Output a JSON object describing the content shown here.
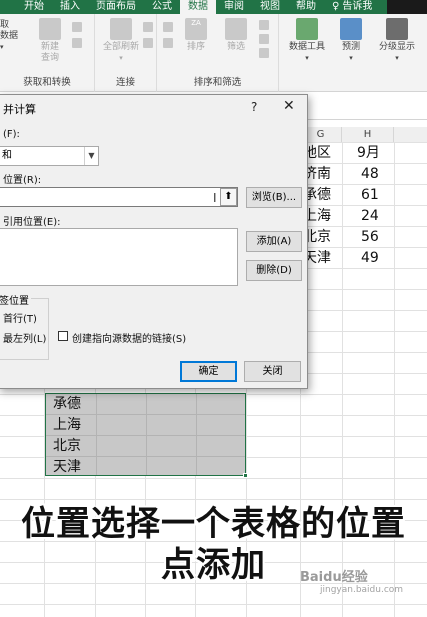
{
  "ribbon_tabs": [
    "开始",
    "插入",
    "页面布局",
    "公式",
    "数据",
    "审阅",
    "视图",
    "帮助",
    "告诉我"
  ],
  "active_tab": "数据",
  "ribbon": {
    "get_data": {
      "label_line1": "取",
      "label_line2": "数据",
      "group_label": "获取和转换",
      "new_query_line1": "新建",
      "new_query_line2": "查询"
    },
    "connections": {
      "refresh_all": "全部刷新",
      "group_label": "连接"
    },
    "sort_filter": {
      "sort": "排序",
      "filter": "筛选",
      "group_label": "排序和筛选",
      "za": "ZA"
    },
    "data_tools": "数据工具",
    "forecast": "预测",
    "outline": "分级显示"
  },
  "sheet": {
    "columns": [
      "G",
      "H"
    ],
    "table_header": {
      "region": "地区",
      "month": "9月"
    },
    "table_rows": [
      {
        "region": "济南",
        "value": "48"
      },
      {
        "region": "承德",
        "value": "61"
      },
      {
        "region": "上海",
        "value": "24"
      },
      {
        "region": "北京",
        "value": "56"
      },
      {
        "region": "天津",
        "value": "49"
      }
    ],
    "lower_rows": [
      "承德",
      "上海",
      "北京",
      "天津"
    ]
  },
  "dialog": {
    "title": "并计算",
    "help": "?",
    "close": "✕",
    "function_label": "(F):",
    "function_value": "和",
    "reference_label": "位置(R):",
    "browse_button": "浏览(B)...",
    "all_refs_label": "引用位置(E):",
    "add_button": "添加(A)",
    "delete_button": "删除(D)",
    "use_labels_label": "签位置",
    "top_row": "首行(T)",
    "left_column": "最左列(L)",
    "link_source": "创建指向源数据的链接(S)",
    "ok_button": "确定",
    "close_button": "关闭"
  },
  "caption": {
    "line1": "位置选择一个表格的位置",
    "line2": "点添加"
  },
  "watermark": {
    "brand": "Baidu经验",
    "url": "jingyan.baidu.com"
  },
  "colors": {
    "excel_green": "#217346",
    "selection_grey": "#c8c8c8",
    "dialog_bg": "#f0f0f0"
  }
}
